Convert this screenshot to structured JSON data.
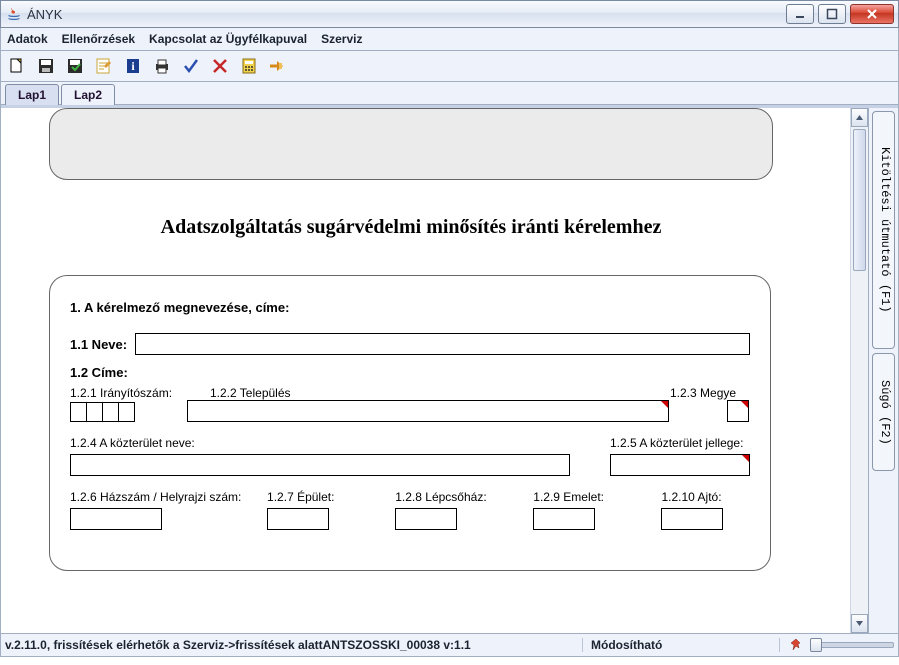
{
  "window": {
    "title": "ÁNYK"
  },
  "menu": {
    "adatok": "Adatok",
    "ellenorzesek": "Ellenőrzések",
    "kapcsolat": "Kapcsolat az Ügyfélkapuval",
    "szerviz": "Szerviz"
  },
  "tabs": {
    "lap1": "Lap1",
    "lap2": "Lap2"
  },
  "side": {
    "guide": "Kitöltési útmutató (F1)",
    "help": "Súgó (F2)"
  },
  "doc": {
    "title": "Adatszolgáltatás sugárvédelmi minősítés iránti kérelemhez",
    "section1": "1. A kérelmező megnevezése, címe:",
    "f11_label": "1.1 Neve:",
    "f11_value": "",
    "f12_label": "1.2 Címe:",
    "f121_label": "1.2.1 Irányítószám:",
    "f121_c1": "",
    "f121_c2": "",
    "f121_c3": "",
    "f121_c4": "",
    "f122_label": "1.2.2 Település",
    "f122_value": "",
    "f123_label": "1.2.3 Megye",
    "f123_value": "",
    "f124_label": "1.2.4 A közterület neve:",
    "f124_value": "",
    "f125_label": "1.2.5 A közterület jellege:",
    "f125_value": "",
    "f126_label": "1.2.6 Házszám / Helyrajzi szám:",
    "f126_value": "",
    "f127_label": "1.2.7 Épület:",
    "f127_value": "",
    "f128_label": "1.2.8 Lépcsőház:",
    "f128_value": "",
    "f129_label": "1.2.9 Emelet:",
    "f129_value": "",
    "f1210_label": "1.2.10 Ajtó:",
    "f1210_value": ""
  },
  "status": {
    "left": "v.2.11.0, frissítések elérhetők a Szerviz->frissítések alattANTSZOSSKI_00038 v:1.1",
    "mode": "Módosítható"
  }
}
